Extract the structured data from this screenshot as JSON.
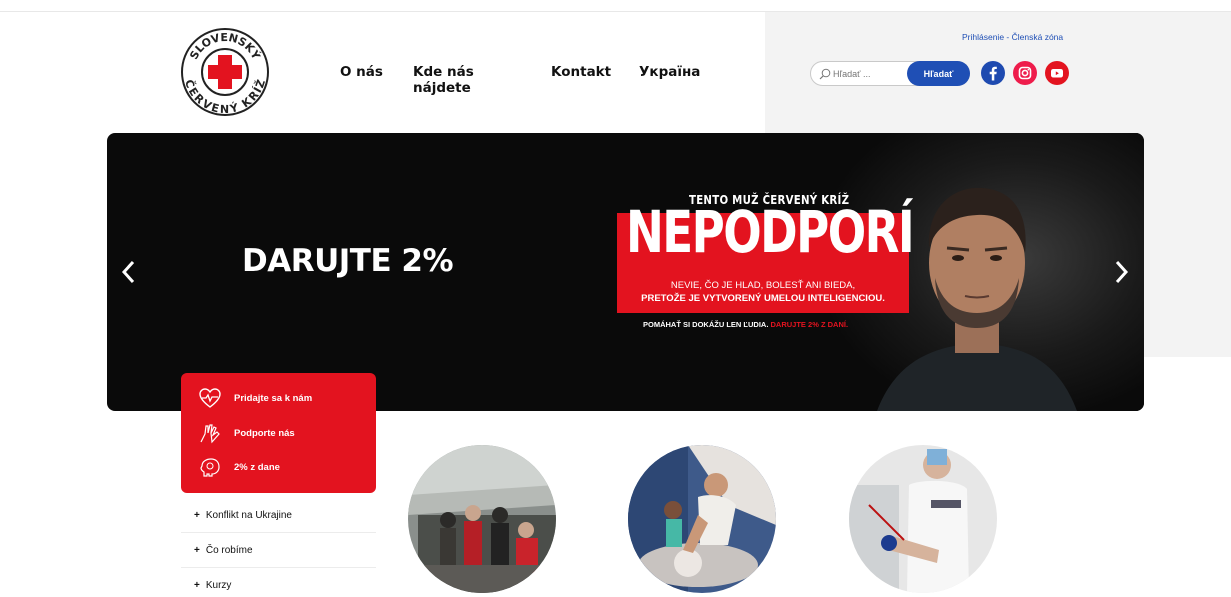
{
  "brand": {
    "name": "Slovenský Červený kríž",
    "logo_top": "SLOVENSKÝ",
    "logo_bottom": "ČERVENÝ KRÍŽ",
    "color": "#e3131f"
  },
  "nav": {
    "items": [
      {
        "label": "O nás"
      },
      {
        "label": "Kde nás nájdete"
      },
      {
        "label": "Kontakt"
      },
      {
        "label": "Україна"
      }
    ]
  },
  "account": {
    "login": "Prihlásenie",
    "separator": " - ",
    "member_zone": "Členská zóna"
  },
  "search": {
    "placeholder": "Hľadať ...",
    "button": "Hľadať"
  },
  "social": [
    {
      "icon": "facebook-icon"
    },
    {
      "icon": "instagram-icon"
    },
    {
      "icon": "youtube-icon"
    }
  ],
  "hero": {
    "title": "DARUJTE 2%",
    "kicker": "TENTO MUŽ ČERVENÝ KRÍŽ",
    "headline": "NEPODPORÍ",
    "line1": "NEVIE, ČO JE HLAD, BOLESŤ ANI BIEDA,",
    "line2": "PRETOŽE JE VYTVORENÝ UMELOU INTELIGENCIOU.",
    "tagline": "POMÁHAŤ SI DOKÁŽU LEN ĽUDIA.",
    "tagline_red": "DARUJTE 2% Z DANÍ."
  },
  "quick_actions": [
    {
      "label": "Pridajte sa k nám",
      "icon": "heart-pulse-icon"
    },
    {
      "label": "Podporte nás",
      "icon": "hands-icon"
    },
    {
      "label": "2% z dane",
      "icon": "piggy-bank-icon"
    }
  ],
  "side_menu": [
    {
      "label": "Konflikt na Ukrajine"
    },
    {
      "label": "Čo robíme"
    },
    {
      "label": "Kurzy"
    }
  ],
  "colors": {
    "accent_blue": "#1f4fb5",
    "red": "#e3131f"
  }
}
